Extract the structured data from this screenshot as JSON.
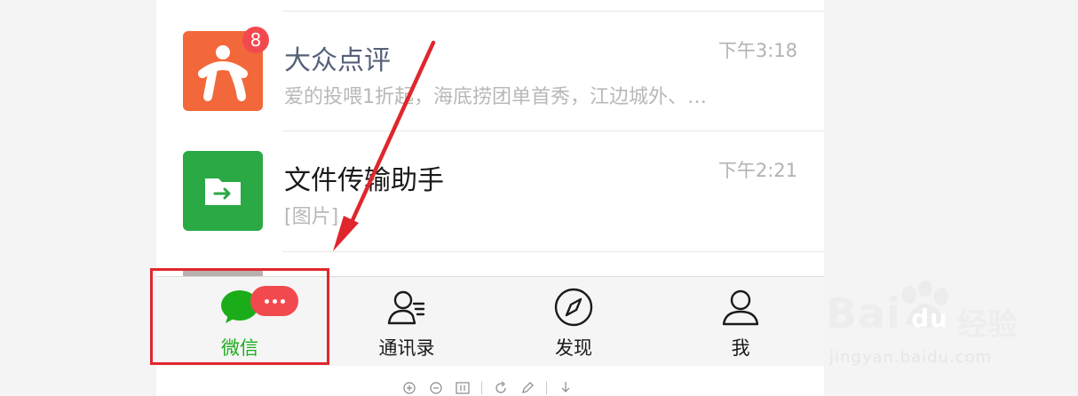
{
  "chats": [
    {
      "name": "大众点评",
      "time": "下午3:18",
      "preview": "爱的投喂1折起，海底捞团单首秀，江边城外、…",
      "unread": "8",
      "icon": "dianping-logo"
    },
    {
      "name": "文件传输助手",
      "time": "下午2:21",
      "preview": "[图片]",
      "icon": "file-transfer-icon"
    }
  ],
  "tabs": [
    {
      "label": "微信",
      "icon": "chat-bubble-icon",
      "active": true
    },
    {
      "label": "通讯录",
      "icon": "contacts-icon"
    },
    {
      "label": "发现",
      "icon": "compass-icon"
    },
    {
      "label": "我",
      "icon": "person-icon"
    }
  ],
  "watermark": {
    "brand": "Bai",
    "brand2": "du",
    "product": "经验",
    "url": "jingyan.baidu.com"
  },
  "colors": {
    "accent_green": "#1aad19",
    "badge_red": "#f2494f",
    "highlight_red": "#e0262d",
    "dianping_orange": "#f2683a",
    "filehelper_green": "#2aa945"
  },
  "viewer_toolbar": [
    "zoom-in-icon",
    "zoom-out-icon",
    "actual-size-icon",
    "rotate-icon",
    "edit-icon",
    "download-icon"
  ]
}
